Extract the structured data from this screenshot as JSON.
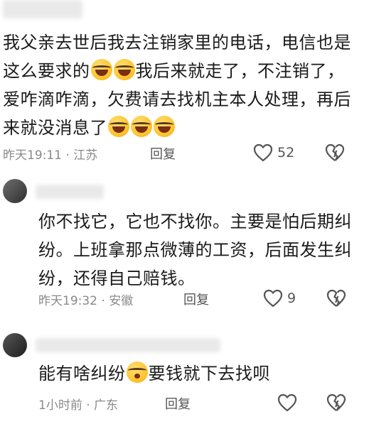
{
  "comment1": {
    "text": {
      "p1": "我父亲去世后我去注销家里的电话，电信也是这么要求的",
      "p2": "我后来就走了，不注销了，爱咋滴咋滴，欠费请去找机主本人处理，再后来就没消息了"
    },
    "time": "昨天19:11",
    "location": "江苏",
    "reply_label": "回复",
    "likes": "52"
  },
  "comment2": {
    "text": "你不找它，它也不找你。主要是怕后期纠纷。上班拿那点微薄的工资，后面发生纠纷，还得自己赔钱。",
    "time": "昨天19:32",
    "location": "安徽",
    "reply_label": "回复",
    "likes": "9"
  },
  "comment3": {
    "text": {
      "p1": "能有啥纠纷",
      "p2": "要钱就下去找呗"
    },
    "time": "1小时前",
    "location": "广东",
    "reply_label": "回复"
  },
  "separator": " · ",
  "icons": {
    "like": "heart-outline-icon",
    "dislike": "broken-heart-icon",
    "emoji_laugh": "rolling-laughing-emoji",
    "emoji_blow": "blowing-kiss-emoji"
  },
  "colors": {
    "meta_text": "#8a8a8a",
    "icon_stroke": "#555555"
  }
}
